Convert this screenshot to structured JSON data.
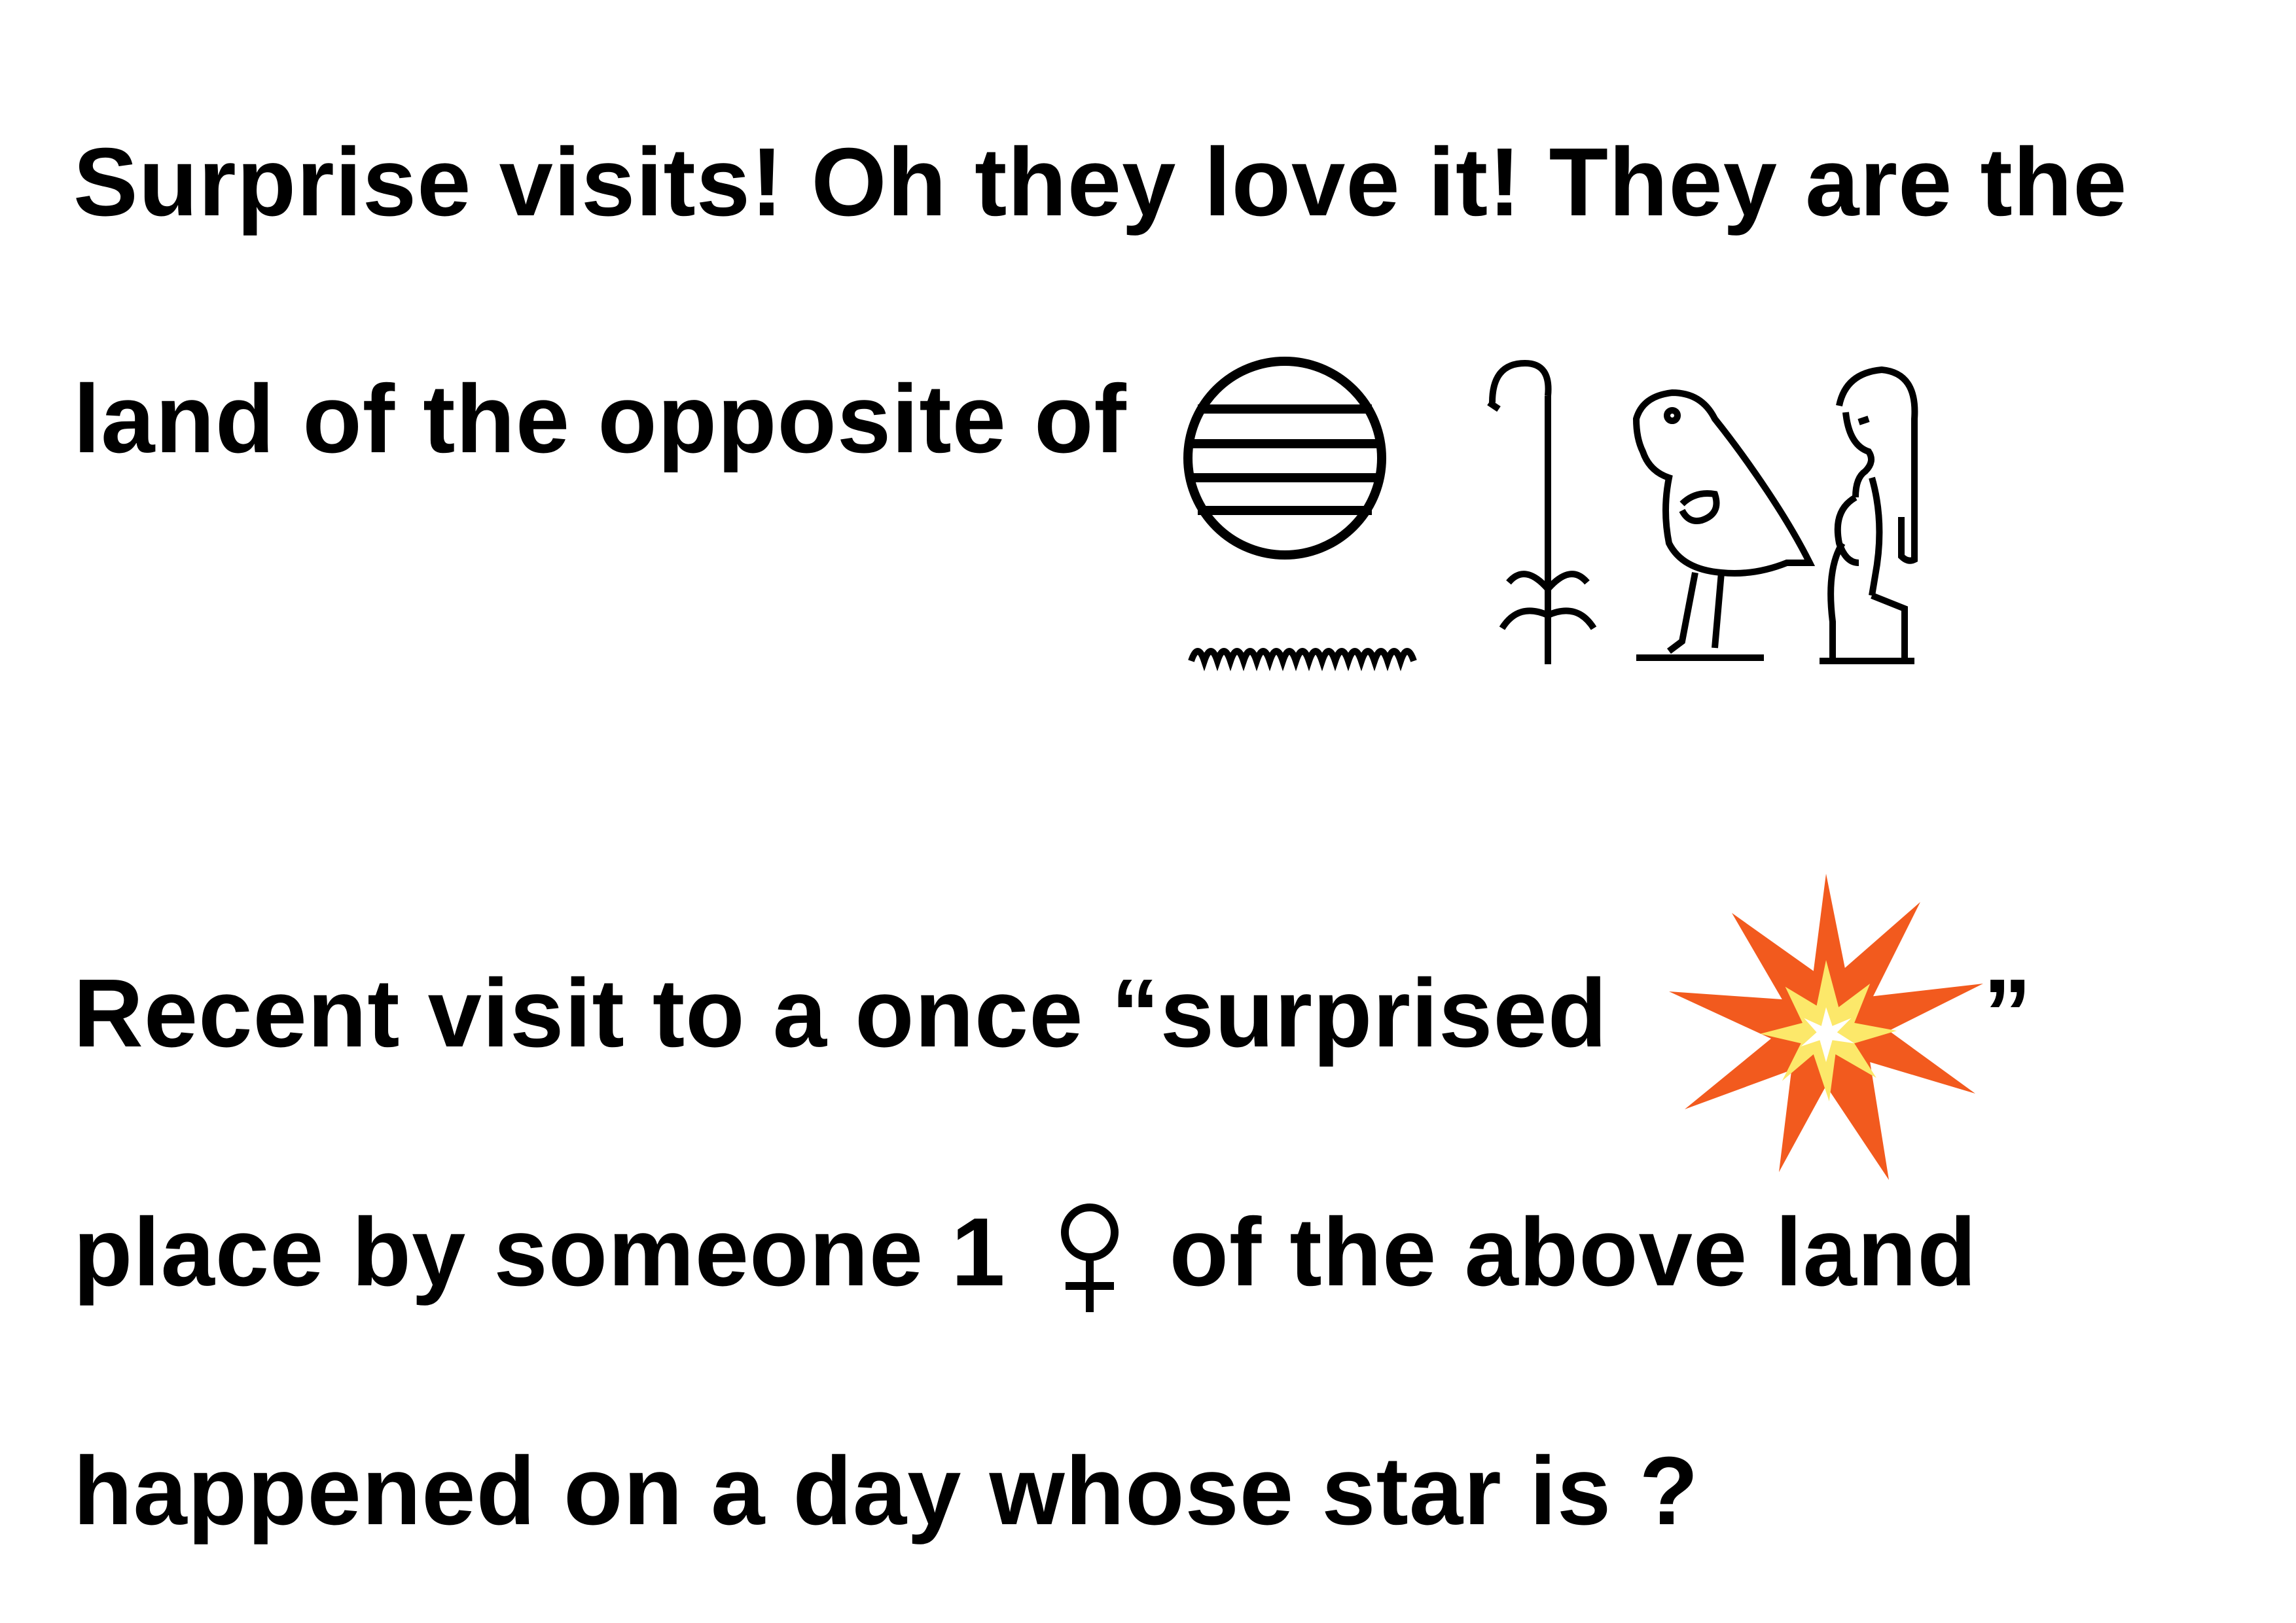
{
  "lines": {
    "line1": "Surprise visits! Oh they love it! They are the",
    "line2": "land of the opposite of",
    "line3": "Recent visit to a once “surprised",
    "line3_close": "”",
    "line4_part1": "place by someone 1",
    "line4_part2": "of the above land",
    "line5": "happened on a day whose star is ?"
  },
  "glyphs": {
    "hieroglyphs": [
      "sun-disk-glyph",
      "water-ripple-glyph",
      "reed-plant-glyph",
      "vulture-bird-glyph",
      "seated-woman-glyph"
    ],
    "burst": "collision-burst-icon",
    "gender": "female-sign-icon"
  },
  "colors": {
    "text": "#000000",
    "burst_outer": "#F25A1E",
    "burst_inner": "#FCE86A",
    "burst_core": "#FFFFFF"
  }
}
